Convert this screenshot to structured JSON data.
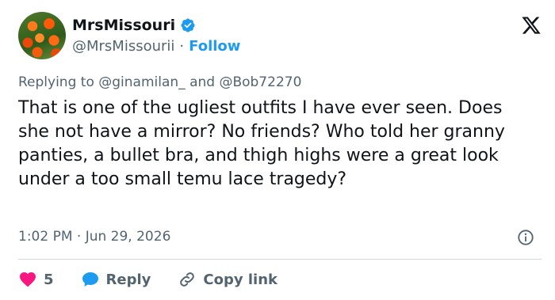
{
  "author": {
    "display_name": "MrsMissouri",
    "handle": "@MrsMissourii",
    "separator": "·",
    "follow_label": "Follow"
  },
  "reply_context": {
    "prefix": "Replying to",
    "mention_1": "@ginamilan_",
    "conjunction": "and",
    "mention_2": "@Bob72270"
  },
  "tweet": {
    "text": "That is one of the ugliest outfits I have ever seen. Does she not have a mirror? No friends? Who told her granny panties, a bullet bra, and thigh highs were a great look under a too small temu lace tragedy?",
    "timestamp": "1:02 PM · Jun 29, 2026"
  },
  "actions": {
    "like_count": "5",
    "reply_label": "Reply",
    "copy_link_label": "Copy link"
  },
  "icons": {
    "verified": "verified-badge-icon",
    "logo": "x-logo-icon",
    "info": "info-icon",
    "heart": "heart-icon",
    "reply": "speech-bubble-icon",
    "link": "link-icon"
  },
  "colors": {
    "accent": "#1d9bf0",
    "heart": "#f91880",
    "secondary_text": "#536471",
    "primary_text": "#0f1419"
  }
}
